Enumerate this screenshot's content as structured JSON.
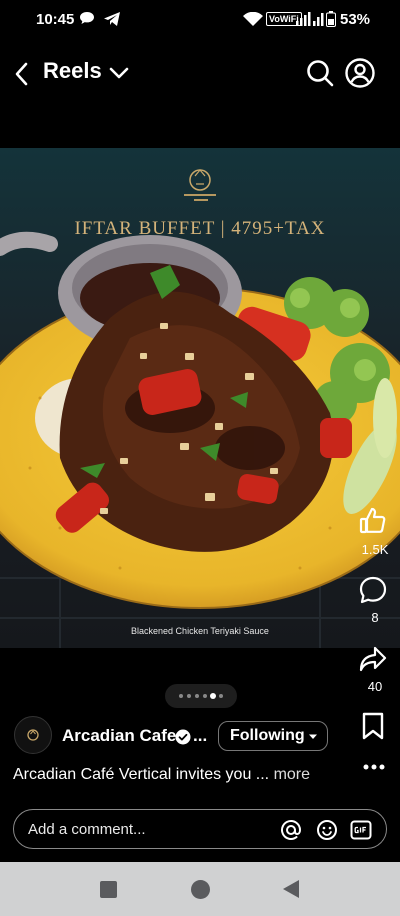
{
  "status_bar": {
    "time": "10:45",
    "vowifi": "VoWiFi",
    "battery": "53%"
  },
  "header": {
    "title": "Reels"
  },
  "post": {
    "promo_title": "IFTAR BUFFET | 4795+TAX",
    "dish_caption": "Blackened Chicken Teriyaki Sauce",
    "author": "Arcadian Cafe",
    "author_ellipsis": "...",
    "follow_label": "Following",
    "caption": "Arcadian Café Vertical invites you ...",
    "caption_more": "more",
    "likes": "1.5K",
    "comments": "8",
    "shares": "40",
    "carousel": {
      "count": 6,
      "active_index": 4
    }
  },
  "comment_input": {
    "placeholder": "Add a comment..."
  },
  "colors": {
    "background": "#000000",
    "nav_bar": "#d0d1d2",
    "plate": "#e8b52a"
  }
}
